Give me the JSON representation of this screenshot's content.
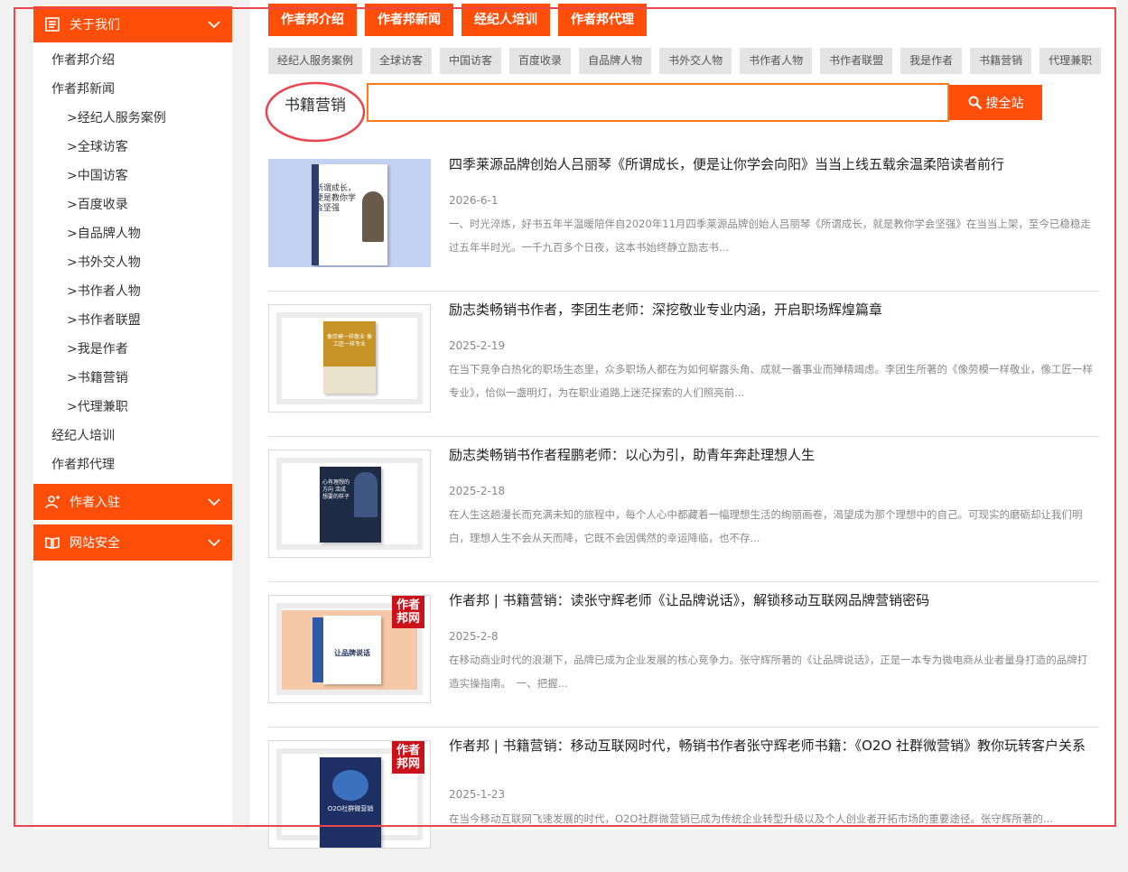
{
  "sidebar": {
    "sections": [
      {
        "label": "关于我们",
        "icon": "list-icon"
      },
      {
        "label": "作者入驻",
        "icon": "user-add-icon"
      },
      {
        "label": "网站安全",
        "icon": "book-icon"
      }
    ],
    "menu_items": [
      {
        "label": "作者邦介绍",
        "sub": false
      },
      {
        "label": "作者邦新闻",
        "sub": false
      },
      {
        "label": ">经纪人服务案例",
        "sub": true
      },
      {
        "label": ">全球访客",
        "sub": true
      },
      {
        "label": ">中国访客",
        "sub": true
      },
      {
        "label": ">百度收录",
        "sub": true
      },
      {
        "label": ">自品牌人物",
        "sub": true
      },
      {
        "label": ">书外交人物",
        "sub": true
      },
      {
        "label": ">书作者人物",
        "sub": true
      },
      {
        "label": ">书作者联盟",
        "sub": true
      },
      {
        "label": ">我是作者",
        "sub": true
      },
      {
        "label": ">书籍营销",
        "sub": true
      },
      {
        "label": ">代理兼职",
        "sub": true
      },
      {
        "label": "经纪人培训",
        "sub": false
      },
      {
        "label": "作者邦代理",
        "sub": false
      }
    ]
  },
  "top_tabs": [
    "作者邦介绍",
    "作者邦新闻",
    "经纪人培训",
    "作者邦代理"
  ],
  "sub_tabs": [
    "经纪人服务案例",
    "全球访客",
    "中国访客",
    "百度收录",
    "自品牌人物",
    "书外交人物",
    "书作者人物",
    "书作者联盟",
    "我是作者",
    "书籍营销",
    "代理兼职"
  ],
  "search": {
    "label": "书籍营销",
    "value": "",
    "button": "搜全站"
  },
  "articles": [
    {
      "title": "四季莱源品牌创始人吕丽琴《所谓成长，便是让你学会向阳》当当上线五载余温柔陪读者前行",
      "date": "2026-6-1",
      "excerpt": "一、时光淬炼，好书五年半温暖陪伴自2020年11月四季莱源品牌创始人吕丽琴《所谓成长，就是教你学会坚强》在当当上架，至今已稳稳走过五年半时光。一千九百多个日夜，这本书始终静立励志书...",
      "thumb_style": "blue",
      "book_text": "所谓成长，便是教你学会坚强"
    },
    {
      "title": "励志类畅销书作者，李团生老师：深挖敬业专业内涵，开启职场辉煌篇章",
      "date": "2025-2-19",
      "excerpt": "在当下竞争白热化的职场生态里，众多职场人都在为如何崭露头角、成就一番事业而殚精竭虑。李团生所著的《像劳模一样敬业，像工匠一样专业》，恰似一盏明灯，为在职业道路上迷茫探索的人们照亮前...",
      "thumb_style": "frame-gold",
      "book_text": "像劳模一样敬业 像工匠一样专业"
    },
    {
      "title": "励志类畅销书作者程鹏老师：以心为引，助青年奔赴理想人生",
      "date": "2025-2-18",
      "excerpt": "在人生这趟漫长而充满未知的旅程中，每个人心中都藏着一幅理想生活的绚丽画卷，渴望成为那个理想中的自己。可现实的磨砺却让我们明白，理想人生不会从天而降，它既不会因偶然的幸运降临，也不存...",
      "thumb_style": "frame-navy",
      "book_text": "心有理想的方向 活成想要的样子"
    },
    {
      "title": "作者邦 | 书籍营销：读张守辉老师《让品牌说话》，解锁移动互联网品牌营销密码",
      "date": "2025-2-8",
      "excerpt": "在移动商业时代的浪潮下，品牌已成为企业发展的核心竞争力。张守辉所著的《让品牌说话》，正是一本专为微电商从业者量身打造的品牌打造实操指南。　一、把握...",
      "thumb_style": "frame-peach",
      "badge": "作者邦网",
      "book_text": "让品牌说话"
    },
    {
      "title": "作者邦 | 书籍营销：移动互联网时代，畅销书作者张守辉老师书籍：《O2O 社群微营销》教你玩转客户关系",
      "date": "2025-1-23",
      "excerpt": "在当今移动互联网飞速发展的时代，O2O社群微营销已成为传统企业转型升级以及个人创业者开拓市场的重要途径。张守辉所著的...",
      "thumb_style": "frame-dark",
      "badge": "作者邦网",
      "book_text": "O2O社群微营销"
    }
  ],
  "colors": {
    "accent": "#ff4e0a",
    "annotation": "#e9464f"
  }
}
